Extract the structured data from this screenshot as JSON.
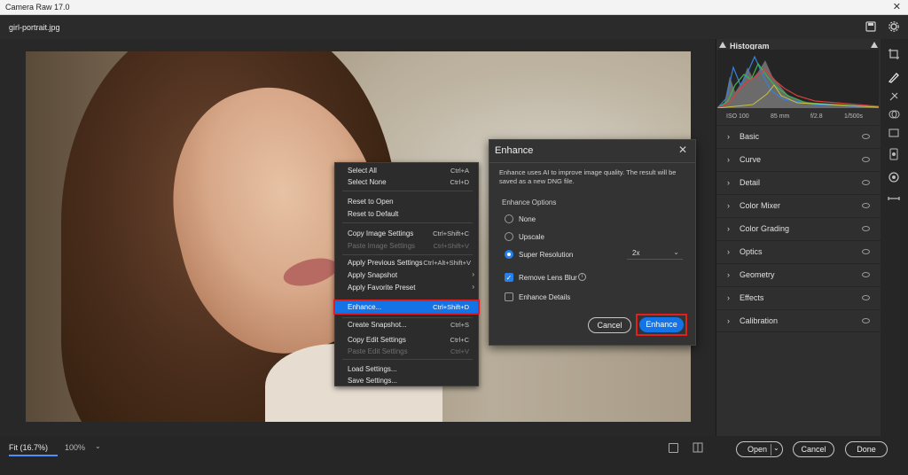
{
  "window": {
    "title": "Camera Raw 17.0",
    "close_glyph": "✕"
  },
  "document": {
    "filename": "girl-portrait.jpg"
  },
  "status": {
    "zoom_fit": "Fit (16.7%)",
    "zoom_100": "100%"
  },
  "panel": {
    "histogram_title": "Histogram",
    "exif": {
      "iso": "ISO 100",
      "focal": "85 mm",
      "aperture": "f/2.8",
      "shutter": "1/500s"
    },
    "sections": [
      "Basic",
      "Curve",
      "Detail",
      "Color Mixer",
      "Color Grading",
      "Optics",
      "Geometry",
      "Effects",
      "Calibration"
    ]
  },
  "footer": {
    "open": "Open",
    "cancel": "Cancel",
    "done": "Done"
  },
  "context_menu": {
    "items": [
      {
        "label": "Select All",
        "shortcut": "Ctrl+A",
        "disabled": false
      },
      {
        "label": "Select None",
        "shortcut": "Ctrl+D",
        "disabled": false
      },
      {
        "label": "Reset to Open",
        "shortcut": "",
        "disabled": false
      },
      {
        "label": "Reset to Default",
        "shortcut": "",
        "disabled": false
      },
      {
        "label": "Copy Image Settings",
        "shortcut": "Ctrl+Shift+C",
        "disabled": false
      },
      {
        "label": "Paste Image Settings",
        "shortcut": "Ctrl+Shift+V",
        "disabled": true
      },
      {
        "label": "Apply Previous Settings",
        "shortcut": "Ctrl+Alt+Shift+V",
        "disabled": false
      },
      {
        "label": "Apply Snapshot",
        "shortcut": "",
        "disabled": false
      },
      {
        "label": "Apply Favorite Preset",
        "shortcut": "",
        "disabled": false
      },
      {
        "label": "Enhance...",
        "shortcut": "Ctrl+Shift+D",
        "disabled": false
      },
      {
        "label": "Create Snapshot...",
        "shortcut": "Ctrl+S",
        "disabled": false
      },
      {
        "label": "Copy Edit Settings",
        "shortcut": "Ctrl+C",
        "disabled": false
      },
      {
        "label": "Paste Edit Settings",
        "shortcut": "Ctrl+V",
        "disabled": true
      },
      {
        "label": "Load Settings...",
        "shortcut": "",
        "disabled": false
      },
      {
        "label": "Save Settings...",
        "shortcut": "",
        "disabled": false
      }
    ]
  },
  "dialog": {
    "title": "Enhance",
    "description": "Enhance uses AI to improve image quality. The result will be saved as a new DNG file.",
    "options_label": "Enhance Options",
    "option_none": "None",
    "option_upscale": "Upscale",
    "option_super": "Super Resolution",
    "scale": "2x",
    "remove_blur": "Remove Lens Blur",
    "enhance_details": "Enhance Details",
    "cancel": "Cancel",
    "enhance": "Enhance"
  },
  "colors": {
    "accent": "#1473e6",
    "highlight_border": "#e0201e"
  }
}
